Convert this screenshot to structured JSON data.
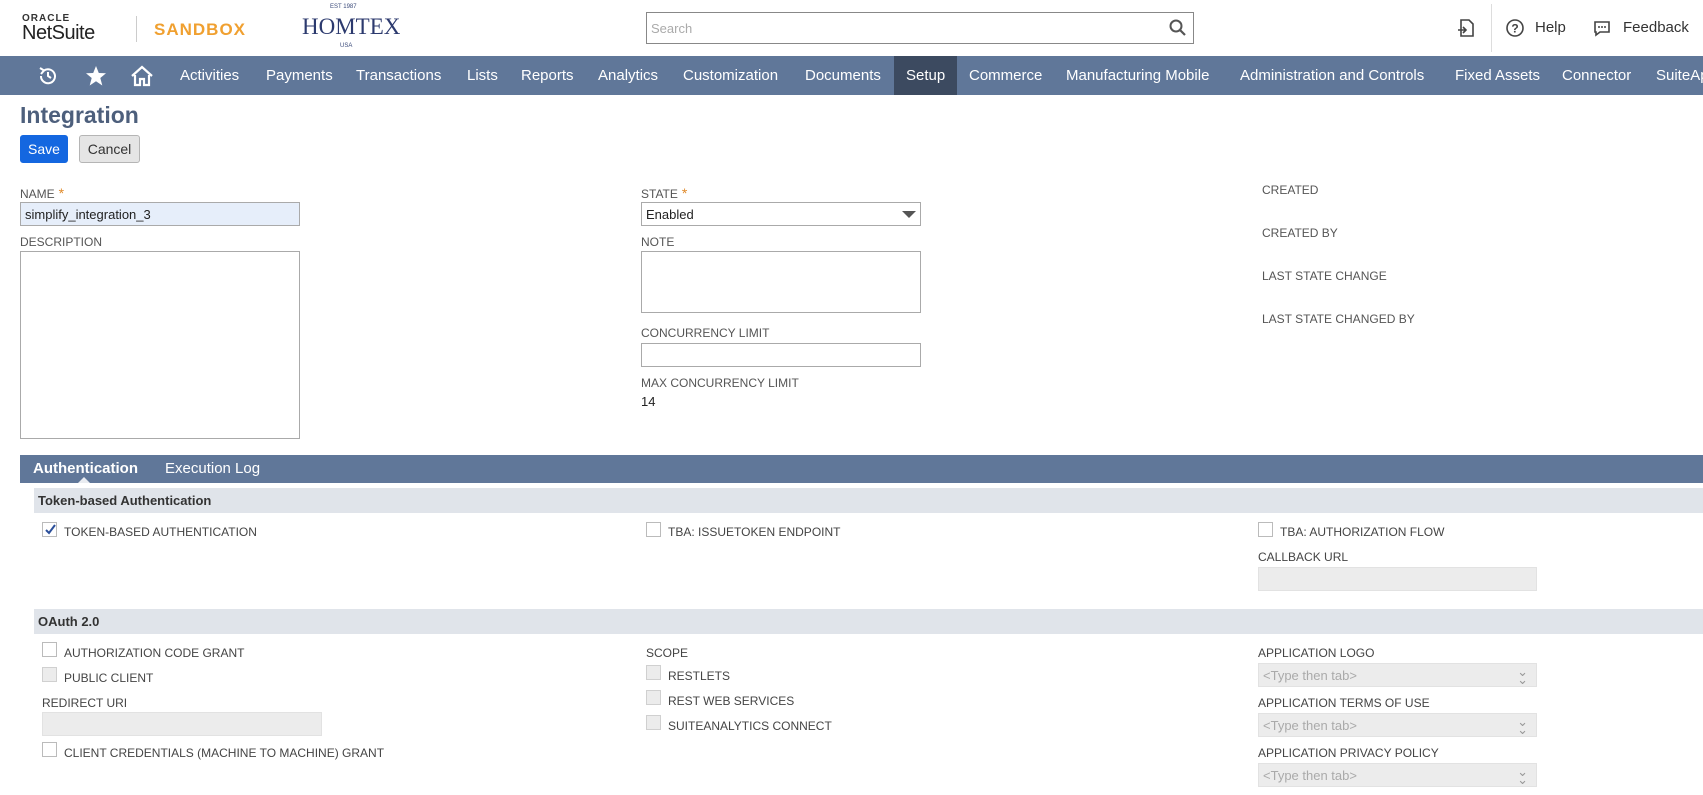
{
  "header": {
    "oracle_label": "ORACLE",
    "netsuite_label": "NetSuite",
    "sandbox_label": "SANDBOX",
    "company": {
      "est": "EST 1987",
      "name": "HOMTEX",
      "country": "USA"
    },
    "search_placeholder": "Search",
    "help_label": "Help",
    "feedback_label": "Feedback"
  },
  "nav": {
    "icons": [
      "recent-records-icon",
      "star-icon",
      "home-icon"
    ],
    "items": [
      {
        "label": "Activities"
      },
      {
        "label": "Payments"
      },
      {
        "label": "Transactions"
      },
      {
        "label": "Lists"
      },
      {
        "label": "Reports"
      },
      {
        "label": "Analytics"
      },
      {
        "label": "Customization"
      },
      {
        "label": "Documents"
      },
      {
        "label": "Setup",
        "active": true
      },
      {
        "label": "Commerce"
      },
      {
        "label": "Manufacturing Mobile"
      },
      {
        "label": "Administration and Controls"
      },
      {
        "label": "Fixed Assets"
      },
      {
        "label": "Connector"
      },
      {
        "label": "SuiteAp"
      }
    ],
    "active_color": "#3c4a60",
    "bar_color": "#607799"
  },
  "page": {
    "title": "Integration",
    "save_label": "Save",
    "cancel_label": "Cancel"
  },
  "form": {
    "name_label": "NAME",
    "name_value": "simplify_integration_3",
    "description_label": "DESCRIPTION",
    "description_value": "",
    "state_label": "STATE",
    "state_value": "Enabled",
    "note_label": "NOTE",
    "concurrency_label": "CONCURRENCY LIMIT",
    "concurrency_value": "",
    "max_concurrency_label": "MAX CONCURRENCY LIMIT",
    "max_concurrency_value": "14",
    "created_label": "CREATED",
    "created_by_label": "CREATED BY",
    "last_state_change_label": "LAST STATE CHANGE",
    "last_state_changed_by_label": "LAST STATE CHANGED BY",
    "required_marker": "*"
  },
  "tabs": {
    "authentication": "Authentication",
    "execution_log": "Execution Log"
  },
  "tba": {
    "section_title": "Token-based Authentication",
    "token_based_auth": {
      "label": "TOKEN-BASED AUTHENTICATION",
      "checked": true
    },
    "issuetoken_endpoint": {
      "label": "TBA: ISSUETOKEN ENDPOINT",
      "checked": false
    },
    "authorization_flow": {
      "label": "TBA: AUTHORIZATION FLOW",
      "checked": false
    },
    "callback_url_label": "CALLBACK URL"
  },
  "oauth": {
    "section_title": "OAuth 2.0",
    "authorization_code_grant": {
      "label": "AUTHORIZATION CODE GRANT",
      "checked": false
    },
    "public_client": {
      "label": "PUBLIC CLIENT",
      "checked": false
    },
    "redirect_uri_label": "REDIRECT URI",
    "client_credentials_grant": {
      "label": "CLIENT CREDENTIALS (MACHINE TO MACHINE) GRANT",
      "checked": false
    },
    "scope_label": "SCOPE",
    "restlets": {
      "label": "RESTLETS",
      "checked": false
    },
    "rest_web_services": {
      "label": "REST WEB SERVICES",
      "checked": false
    },
    "suiteanalytics_connect": {
      "label": "SUITEANALYTICS CONNECT",
      "checked": false
    },
    "application_logo_label": "APPLICATION LOGO",
    "application_terms_label": "APPLICATION TERMS OF USE",
    "application_privacy_label": "APPLICATION PRIVACY POLICY",
    "type_then_tab_placeholder": "<Type then tab>"
  }
}
